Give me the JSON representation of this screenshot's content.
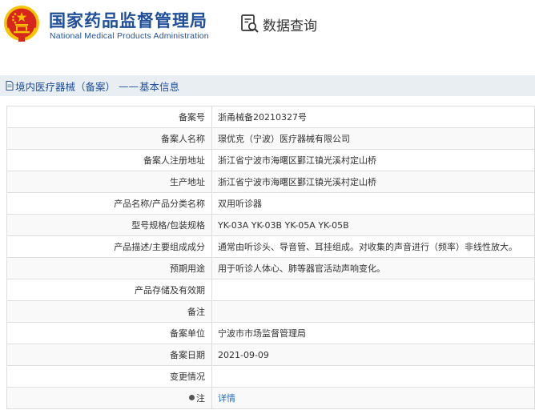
{
  "header": {
    "brand_cn": "国家药品监督管理局",
    "brand_en": "National Medical Products Administration",
    "query_label": "数据查询",
    "query_icon": "search-document-icon",
    "emblem": "national-emblem-icon"
  },
  "breadcrumb": {
    "section": "境内医疗器械（备案）",
    "separator": "——",
    "page": "基本信息"
  },
  "table": {
    "rows": [
      {
        "label": "备案号",
        "value": "浙甬械备20210327号"
      },
      {
        "label": "备案人名称",
        "value": "璟优克（宁波）医疗器械有限公司"
      },
      {
        "label": "备案人注册地址",
        "value": "浙江省宁波市海曙区鄞江镇光溪村定山桥"
      },
      {
        "label": "生产地址",
        "value": "浙江省宁波市海曙区鄞江镇光溪村定山桥"
      },
      {
        "label": "产品名称/产品分类名称",
        "value": "双用听诊器"
      },
      {
        "label": "型号规格/包装规格",
        "value": "YK-03A YK-03B YK-05A YK-05B"
      },
      {
        "label": "产品描述/主要组成成分",
        "value": "通常由听诊头、导音管、耳挂组成。对收集的声音进行（频率）非线性放大。"
      },
      {
        "label": "预期用途",
        "value": "用于听诊人体心、肺等器官活动声响变化。"
      },
      {
        "label": "产品存储及有效期",
        "value": ""
      },
      {
        "label": "备注",
        "value": ""
      },
      {
        "label": "备案单位",
        "value": "宁波市市场监督管理局"
      },
      {
        "label": "备案日期",
        "value": "2021-09-09"
      },
      {
        "label": "变更情况",
        "value": ""
      }
    ],
    "note_label": "注",
    "note_link": "详情"
  },
  "colors": {
    "brand_blue": "#1f4e9a",
    "link_blue": "#1f6fc5",
    "breadcrumb_bg": "#e9eef3",
    "emblem_red": "#d7261e",
    "emblem_gold": "#f5c400"
  }
}
